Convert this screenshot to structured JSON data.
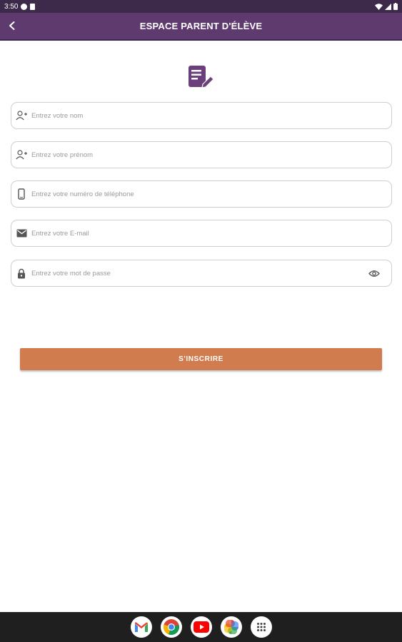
{
  "status_bar": {
    "time": "3:50"
  },
  "header": {
    "title": "ESPACE PARENT D'ÉLÈVE"
  },
  "form": {
    "fields": [
      {
        "placeholder": "Entrez votre nom",
        "icon": "add-person-icon"
      },
      {
        "placeholder": "Entrez votre prénom",
        "icon": "add-person-icon"
      },
      {
        "placeholder": "Entrez votre numéro de téléphone",
        "icon": "phone-icon"
      },
      {
        "placeholder": "Entrez votre E-mail",
        "icon": "mail-icon"
      },
      {
        "placeholder": "Entrez votre mot de passe",
        "icon": "lock-icon"
      }
    ],
    "submit_label": "S'INSCRIRE"
  },
  "taskbar": {
    "apps": [
      "gmail",
      "chrome",
      "youtube",
      "photos",
      "app-drawer"
    ]
  },
  "colors": {
    "appbar": "#5e3a6e",
    "button": "#d17c4f",
    "icon": "#6a3f7c"
  }
}
